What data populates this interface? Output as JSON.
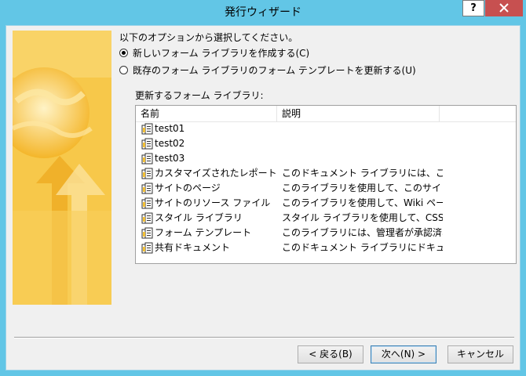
{
  "window": {
    "title": "発行ウィザード",
    "help_label": "?",
    "close_label": "X"
  },
  "instruction": "以下のオプションから選択してください。",
  "options": [
    {
      "label": "新しいフォーム ライブラリを作成する(C)",
      "selected": true
    },
    {
      "label": "既存のフォーム ライブラリのフォーム テンプレートを更新する(U)",
      "selected": false
    }
  ],
  "list_label": "更新するフォーム ライブラリ:",
  "columns": [
    "名前",
    "説明"
  ],
  "rows": [
    {
      "name": "test01",
      "desc": ""
    },
    {
      "name": "test02",
      "desc": ""
    },
    {
      "name": "test03",
      "desc": ""
    },
    {
      "name": "カスタマイズされたレポート",
      "desc": "このドキュメント ライブラリには、このサイ..."
    },
    {
      "name": "サイトのページ",
      "desc": "このライブラリを使用して、このサイトでペ..."
    },
    {
      "name": "サイトのリソース ファイル",
      "desc": "このライブラリを使用して、Wiki ページ..."
    },
    {
      "name": "スタイル ライブラリ",
      "desc": "スタイル ライブラリを使用して、CSS ファ..."
    },
    {
      "name": "フォーム テンプレート",
      "desc": "このライブラリには、管理者が承認済み..."
    },
    {
      "name": "共有ドキュメント",
      "desc": "このドキュメント ライブラリにドキュメントを..."
    }
  ],
  "buttons": {
    "back": "< 戻る(B)",
    "next": "次へ(N) >",
    "cancel": "キャンセル"
  },
  "icons": {
    "row_icon": "document-library-icon",
    "banner": "globe-arrow-illustration"
  },
  "colors": {
    "titlebar": "#62c6e6",
    "close": "#c75050",
    "banner": "#f6c13d"
  }
}
